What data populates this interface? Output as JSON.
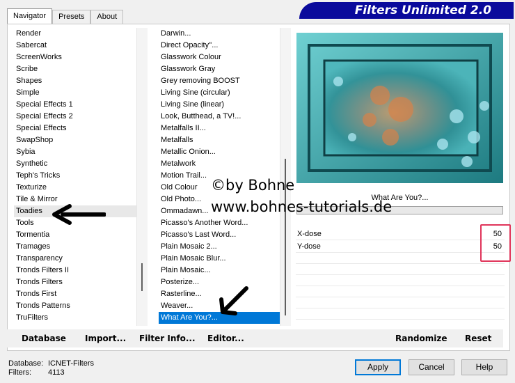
{
  "tabs": [
    "Navigator",
    "Presets",
    "About"
  ],
  "banner_title": "Filters Unlimited 2.0",
  "categories": [
    "Render",
    "Sabercat",
    "ScreenWorks",
    "Scribe",
    "Shapes",
    "Simple",
    "Special Effects 1",
    "Special Effects 2",
    "Special Effects",
    "SwapShop",
    "Sybia",
    "Synthetic",
    "Teph's Tricks",
    "Texturize",
    "Tile & Mirror",
    "Toadies",
    "Tools",
    "Tormentia",
    "Tramages",
    "Transparency",
    "Tronds Filters II",
    "Tronds Filters",
    "Tronds First",
    "Tronds Patterns",
    "TruFilters"
  ],
  "selected_category": "Toadies",
  "filters": [
    "Darwin...",
    "Direct Opacity''...",
    "Glasswork Colour",
    "Glasswork Gray",
    "Grey removing BOOST",
    "Living Sine (circular)",
    "Living Sine (linear)",
    "Look, Butthead, a TV!...",
    "Metalfalls II...",
    "Metalfalls",
    "Metallic Onion...",
    "Metalwork",
    "Motion Trail...",
    "Old Colour",
    "Old Photo...",
    "Ommadawn...",
    "Picasso's Another Word...",
    "Picasso's Last Word...",
    "Plain Mosaic 2...",
    "Plain Mosaic Blur...",
    "Plain Mosaic...",
    "Posterize...",
    "Rasterline...",
    "Weaver...",
    "What Are You?..."
  ],
  "selected_filter": "What Are You?...",
  "preview_filter_name": "What Are You?...",
  "params": [
    {
      "label": "X-dose",
      "value": "50"
    },
    {
      "label": "Y-dose",
      "value": "50"
    }
  ],
  "bottom_buttons": {
    "database": "Database",
    "import": "Import...",
    "filter_info": "Filter Info...",
    "editor": "Editor...",
    "randomize": "Randomize",
    "reset": "Reset"
  },
  "status": {
    "database_label": "Database:",
    "database_value": "ICNET-Filters",
    "filters_label": "Filters:",
    "filters_value": "4113"
  },
  "dialog_buttons": {
    "apply": "Apply",
    "cancel": "Cancel",
    "help": "Help"
  },
  "watermark": {
    "line1": "©by Bohne",
    "line2": "www.bohnes-tutorials.de"
  },
  "colors": {
    "banner": "#0a0a9c",
    "selection": "#0078d7",
    "highlight_box": "#e0345a",
    "preview_teal": "#35a8ad"
  }
}
